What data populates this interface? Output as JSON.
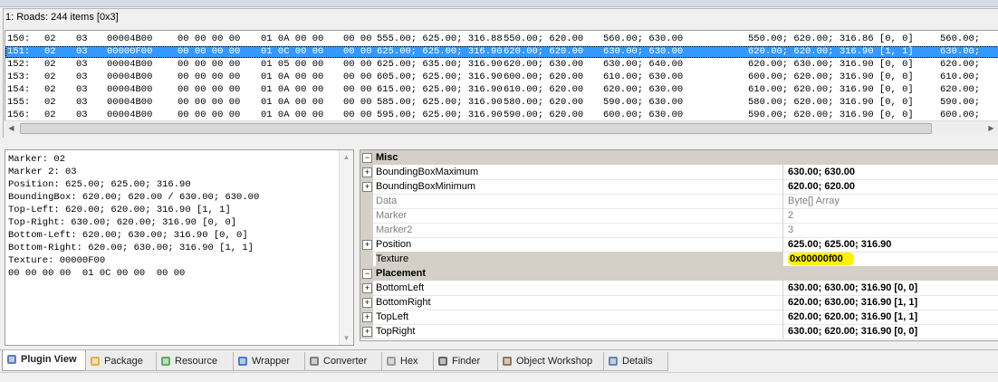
{
  "window": {
    "group_title": "1: Roads: 244 items [0x3]"
  },
  "list": {
    "rows": [
      {
        "idx": "150:",
        "m1": "02",
        "m2": "03",
        "tex": "00004B00",
        "b1": "00 00 00 00",
        "b2": "01 0A 00 00",
        "b3": "00 00",
        "pos": "555.00; 625.00; 316.88",
        "c1": "550.00; 620.00",
        "c2": "560.00; 630.00",
        "c3": "550.00; 620.00; 316.86 [0, 0]",
        "c4": "560.00;",
        "selected": false
      },
      {
        "idx": "151:",
        "m1": "02",
        "m2": "03",
        "tex": "00000F00",
        "b1": "00 00 00 00",
        "b2": "01 0C 00 00",
        "b3": "00 00",
        "pos": "625.00; 625.00; 316.90",
        "c1": "620.00; 620.00",
        "c2": "630.00; 630.00",
        "c3": "620.00; 620.00; 316.90 [1, 1]",
        "c4": "630.00;",
        "selected": true
      },
      {
        "idx": "152:",
        "m1": "02",
        "m2": "03",
        "tex": "00004B00",
        "b1": "00 00 00 00",
        "b2": "01 05 00 00",
        "b3": "00 00",
        "pos": "625.00; 635.00; 316.90",
        "c1": "620.00; 630.00",
        "c2": "630.00; 640.00",
        "c3": "620.00; 630.00; 316.90 [0, 0]",
        "c4": "620.00;",
        "selected": false
      },
      {
        "idx": "153:",
        "m1": "02",
        "m2": "03",
        "tex": "00004B00",
        "b1": "00 00 00 00",
        "b2": "01 0A 00 00",
        "b3": "00 00",
        "pos": "605.00; 625.00; 316.90",
        "c1": "600.00; 620.00",
        "c2": "610.00; 630.00",
        "c3": "600.00; 620.00; 316.90 [0, 0]",
        "c4": "610.00;",
        "selected": false
      },
      {
        "idx": "154:",
        "m1": "02",
        "m2": "03",
        "tex": "00004B00",
        "b1": "00 00 00 00",
        "b2": "01 0A 00 00",
        "b3": "00 00",
        "pos": "615.00; 625.00; 316.90",
        "c1": "610.00; 620.00",
        "c2": "620.00; 630.00",
        "c3": "610.00; 620.00; 316.90 [0, 0]",
        "c4": "620.00;",
        "selected": false
      },
      {
        "idx": "155:",
        "m1": "02",
        "m2": "03",
        "tex": "00004B00",
        "b1": "00 00 00 00",
        "b2": "01 0A 00 00",
        "b3": "00 00",
        "pos": "585.00; 625.00; 316.90",
        "c1": "580.00; 620.00",
        "c2": "590.00; 630.00",
        "c3": "580.00; 620.00; 316.90 [0, 0]",
        "c4": "590.00;",
        "selected": false
      },
      {
        "idx": "156:",
        "m1": "02",
        "m2": "03",
        "tex": "00004B00",
        "b1": "00 00 00 00",
        "b2": "01 0A 00 00",
        "b3": "00 00",
        "pos": "595.00; 625.00; 316.90",
        "c1": "590.00; 620.00",
        "c2": "600.00; 630.00",
        "c3": "590.00; 620.00; 316.90 [0, 0]",
        "c4": "600.00;",
        "selected": false
      }
    ]
  },
  "details_text": [
    "Marker: 02",
    "Marker 2: 03",
    "Position: 625.00; 625.00; 316.90",
    "BoundingBox: 620.00; 620.00 / 630.00; 630.00",
    "Top-Left: 620.00; 620.00; 316.90 [1, 1]",
    "Top-Right: 630.00; 620.00; 316.90 [0, 0]",
    "Bottom-Left: 620.00; 630.00; 316.90 [0, 0]",
    "Bottom-Right: 620.00; 630.00; 316.90 [1, 1]",
    "Texture: 00000F00",
    "00 00 00 00  01 0C 00 00  00 00"
  ],
  "grid": {
    "misc": {
      "title": "Misc",
      "props": [
        {
          "name": "BoundingBoxMaximum",
          "value": "630.00; 630.00",
          "expandable": true,
          "readonly": false
        },
        {
          "name": "BoundingBoxMinimum",
          "value": "620.00; 620.00",
          "expandable": true,
          "readonly": false
        },
        {
          "name": "Data",
          "value": "Byte[] Array",
          "expandable": false,
          "readonly": true
        },
        {
          "name": "Marker",
          "value": "2",
          "expandable": false,
          "readonly": true
        },
        {
          "name": "Marker2",
          "value": "3",
          "expandable": false,
          "readonly": true
        },
        {
          "name": "Position",
          "value": "625.00; 625.00; 316.90",
          "expandable": true,
          "readonly": false
        },
        {
          "name": "Texture",
          "value": "0x00000f00",
          "expandable": false,
          "readonly": false,
          "highlight": true
        }
      ]
    },
    "placement": {
      "title": "Placement",
      "props": [
        {
          "name": "BottomLeft",
          "value": "630.00; 630.00; 316.90 [0, 0]",
          "expandable": true
        },
        {
          "name": "BottomRight",
          "value": "620.00; 630.00; 316.90 [1, 1]",
          "expandable": true
        },
        {
          "name": "TopLeft",
          "value": "620.00; 620.00; 316.90 [1, 1]",
          "expandable": true
        },
        {
          "name": "TopRight",
          "value": "630.00; 620.00; 316.90 [0, 0]",
          "expandable": true
        }
      ]
    }
  },
  "tabs": [
    {
      "label": "Plugin View",
      "icon": "plugin-view-icon",
      "active": true
    },
    {
      "label": "Package",
      "icon": "package-icon",
      "active": false
    },
    {
      "label": "Resource",
      "icon": "resource-icon",
      "active": false
    },
    {
      "label": "Wrapper",
      "icon": "wrapper-icon",
      "active": false
    },
    {
      "label": "Converter",
      "icon": "converter-icon",
      "active": false
    },
    {
      "label": "Hex",
      "icon": "hex-icon",
      "active": false
    },
    {
      "label": "Finder",
      "icon": "finder-icon",
      "active": false
    },
    {
      "label": "Object Workshop",
      "icon": "object-workshop-icon",
      "active": false
    },
    {
      "label": "Details",
      "icon": "details-icon",
      "active": false
    }
  ],
  "colors": {
    "selection": "#3399ff",
    "highlight": "#fff200",
    "category": "#d4d0c8"
  }
}
